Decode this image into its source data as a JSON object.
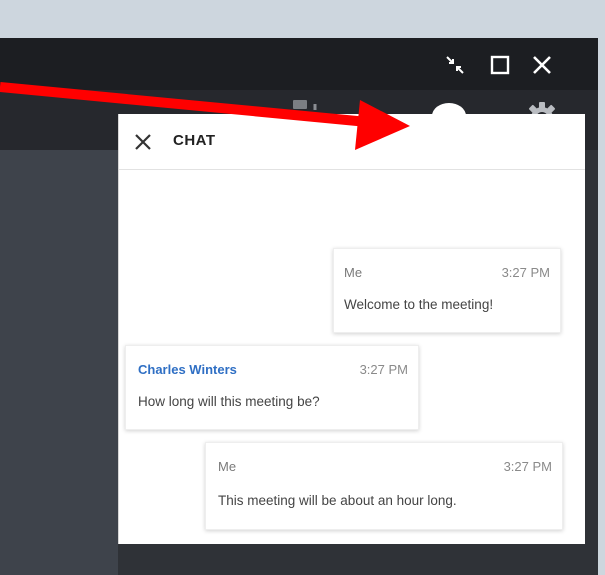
{
  "window_controls": {
    "shrink_icon": "shrink-arrows-icon",
    "maximize_icon": "maximize-icon",
    "close_icon": "close-icon"
  },
  "toolbar": {
    "share_icon": "share-screen-icon",
    "chat_icon": "chat-bubble-icon",
    "settings_icon": "gear-icon",
    "active_accent": "#e38a3a"
  },
  "chat": {
    "title": "CHAT",
    "messages": [
      {
        "sender": "Me",
        "time": "3:27 PM",
        "text": "Welcome to the meeting!"
      },
      {
        "sender": "Charles Winters",
        "time": "3:27 PM",
        "text": "How long will this meeting be?"
      },
      {
        "sender": "Me",
        "time": "3:27 PM",
        "text": "This meeting will be about an hour long."
      }
    ]
  },
  "annotation": {
    "arrow_color": "#ff0000"
  }
}
